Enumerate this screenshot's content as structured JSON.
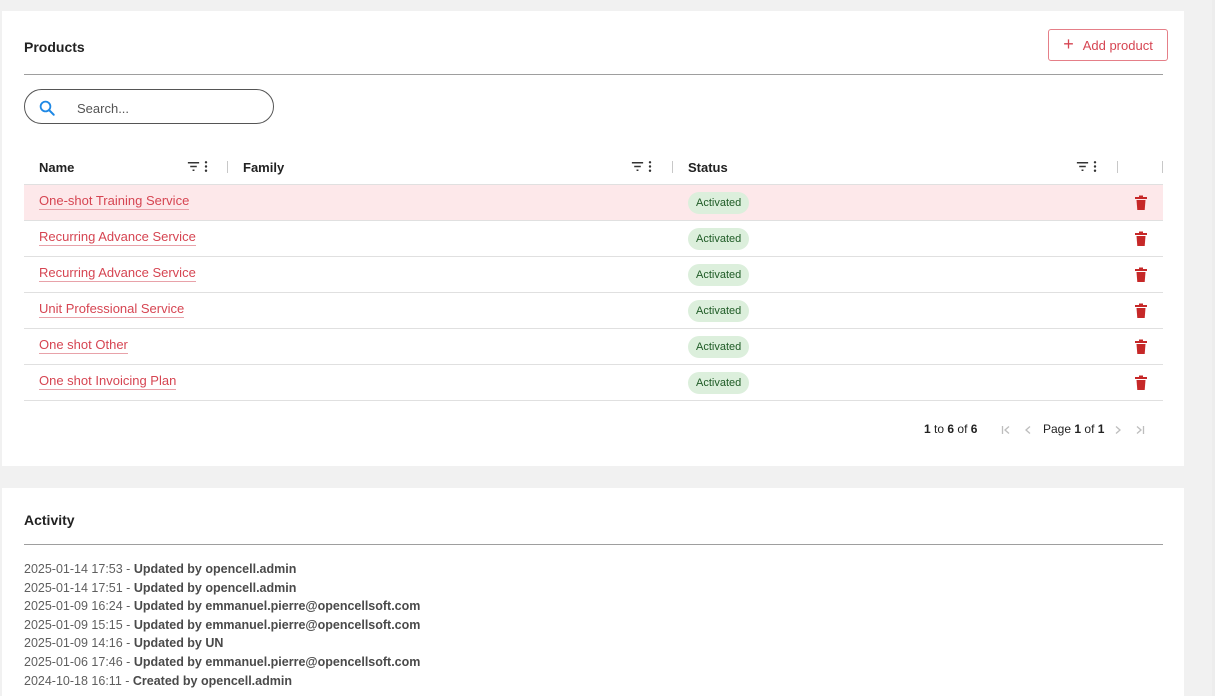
{
  "products": {
    "title": "Products",
    "add_label": "Add product",
    "search_placeholder": "Search...",
    "columns": {
      "name": "Name",
      "family": "Family",
      "status": "Status"
    },
    "rows": [
      {
        "name": "One-shot Training Service",
        "family": "",
        "status": "Activated"
      },
      {
        "name": "Recurring Advance Service",
        "family": "",
        "status": "Activated"
      },
      {
        "name": "Recurring Advance Service",
        "family": "",
        "status": "Activated"
      },
      {
        "name": "Unit Professional Service",
        "family": "",
        "status": "Activated"
      },
      {
        "name": "One shot Other",
        "family": "",
        "status": "Activated"
      },
      {
        "name": "One shot Invoicing Plan",
        "family": "",
        "status": "Activated"
      }
    ],
    "pagination": {
      "from": "1",
      "to_word": "to",
      "to": "6",
      "of_word": "of",
      "total": "6",
      "page_word": "Page",
      "page": "1",
      "page_of_word": "of",
      "pages": "1"
    }
  },
  "activity": {
    "title": "Activity",
    "entries": [
      {
        "time": "2025-01-14 17:53 -",
        "text": "Updated by opencell.admin"
      },
      {
        "time": "2025-01-14 17:51 -",
        "text": "Updated by opencell.admin"
      },
      {
        "time": "2025-01-09 16:24 -",
        "text": "Updated by emmanuel.pierre@opencellsoft.com"
      },
      {
        "time": "2025-01-09 15:15 -",
        "text": "Updated by emmanuel.pierre@opencellsoft.com"
      },
      {
        "time": "2025-01-09 14:16 -",
        "text": "Updated by UN"
      },
      {
        "time": "2025-01-06 17:46 -",
        "text": "Updated by emmanuel.pierre@opencellsoft.com"
      },
      {
        "time": "2024-10-18 16:11 -",
        "text": "Created by opencell.admin"
      }
    ]
  },
  "colors": {
    "accent": "#d64552",
    "badge_bg": "#dcefdc",
    "badge_text": "#1e5b25",
    "row_highlight": "#fde8ea",
    "delete_icon": "#c62828",
    "search_icon": "#1e88e5"
  },
  "icons": {
    "search": "search-icon",
    "filter": "filter-icon",
    "more": "more-vertical-icon",
    "delete": "trash-icon",
    "first_page": "first-page-icon",
    "prev_page": "chevron-left-icon",
    "next_page": "chevron-right-icon",
    "last_page": "last-page-icon"
  }
}
